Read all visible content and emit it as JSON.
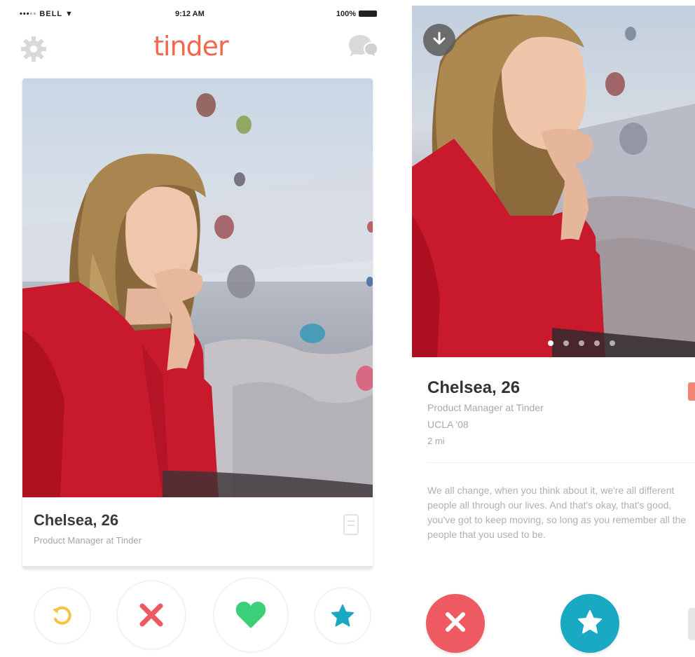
{
  "status_bar": {
    "carrier": "•••◦◦ BELL ▼",
    "time": "9:12 AM",
    "battery": "100%"
  },
  "header": {
    "logo": "tinder",
    "settings_icon": "gear-icon",
    "messages_icon": "chat-bubbles-icon"
  },
  "card": {
    "name": "Chelsea, 26",
    "job": "Product Manager at Tinder",
    "info_icon": "info-icon"
  },
  "actions_left": {
    "rewind_icon": "rewind-icon",
    "nope_icon": "x-icon",
    "like_icon": "heart-icon",
    "super_like_icon": "star-icon"
  },
  "profile": {
    "download_icon": "down-arrow-icon",
    "photo_count": 5,
    "active_photo": 1,
    "name": "Chelsea, 26",
    "job": "Product Manager at Tinder",
    "school": "UCLA '08",
    "distance": "2 mi",
    "bio": "We all change, when you think about it, we're all different people all through our lives. And that's okay, that's good, you've got to keep moving, so long as you remember all the people that you used to be."
  },
  "actions_right": {
    "nope_icon": "x-icon",
    "super_like_icon": "star-icon"
  },
  "colors": {
    "brand": "#f0684d",
    "nope": "#ee5a62",
    "like": "#3ccf7a",
    "super_like": "#1aa9c2",
    "rewind": "#f5c443",
    "shirt": "#c9192c"
  }
}
